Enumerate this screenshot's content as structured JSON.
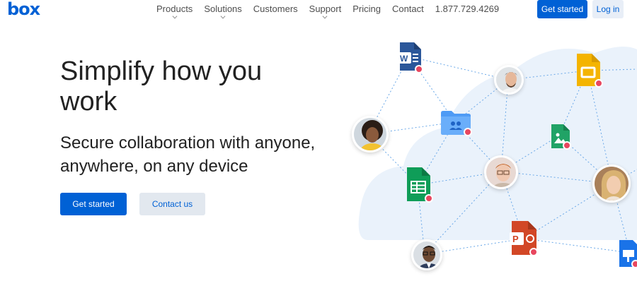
{
  "header": {
    "logo_text": "box",
    "nav": [
      {
        "label": "Products",
        "has_dropdown": true
      },
      {
        "label": "Solutions",
        "has_dropdown": true
      },
      {
        "label": "Customers",
        "has_dropdown": false
      },
      {
        "label": "Support",
        "has_dropdown": true
      },
      {
        "label": "Pricing",
        "has_dropdown": false
      },
      {
        "label": "Contact",
        "has_dropdown": false
      }
    ],
    "phone": "1.877.729.4269",
    "get_started_label": "Get started",
    "login_label": "Log in"
  },
  "hero": {
    "title": "Simplify how you work",
    "subtitle": "Secure collaboration with anyone, anywhere, on any device",
    "primary_cta": "Get started",
    "secondary_cta": "Contact us"
  },
  "colors": {
    "brand_blue": "#0061d5",
    "cloud": "#eaf2fb",
    "lock_badge": "#e8475f"
  }
}
